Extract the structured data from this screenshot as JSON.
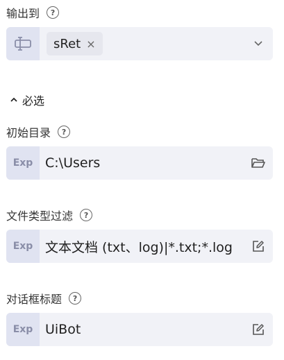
{
  "output": {
    "label": "输出到",
    "help": "?",
    "tag": "sRet",
    "tag_close": "×"
  },
  "section": {
    "toggle_label": "必选"
  },
  "initial_dir": {
    "label": "初始目录",
    "help": "?",
    "prefix": "Exp",
    "value": "C:\\Users"
  },
  "file_filter": {
    "label": "文件类型过滤",
    "help": "?",
    "prefix": "Exp",
    "value": "文本文档 (txt、log)|*.txt;*.log"
  },
  "dialog_title": {
    "label": "对话框标题",
    "help": "?",
    "prefix": "Exp",
    "value": "UiBot"
  }
}
